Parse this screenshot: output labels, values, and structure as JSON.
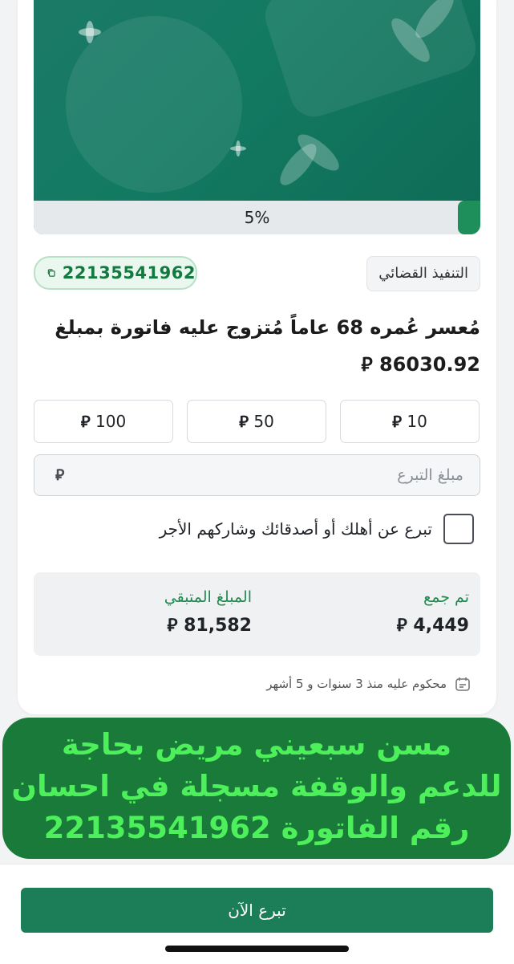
{
  "progress": {
    "percent": 0.05,
    "label": "5%"
  },
  "case": {
    "category": "التنفيذ القضائي",
    "invoice_number": "22135541962",
    "title_line1": "مُعسر عُمره 68 عاماً مُتزوج عليه فاتورة بمبلغ",
    "title_amount": "86030.92",
    "currency_symbol": "⃁"
  },
  "amount_options": [
    {
      "value": "10"
    },
    {
      "value": "50"
    },
    {
      "value": "100"
    }
  ],
  "donation_input": {
    "placeholder": "مبلغ التبرع"
  },
  "gift_option": {
    "label": "تبرع عن أهلك أو أصدقائك وشاركهم الأجر",
    "checked": false
  },
  "stats": {
    "collected_label": "تم جمع",
    "collected_value": "4,449",
    "remaining_label": "المبلغ المتبقي",
    "remaining_value": "81,582"
  },
  "status": {
    "text": "محكوم عليه منذ 3 سنوات و 5 أشهر"
  },
  "overlay": {
    "line1": "مسن سبعيني مريض بحاجة",
    "line2": "للدعم والوقفة مسجلة في احسان",
    "line3": "رقم الفاتورة 22135541962"
  },
  "cta": {
    "label": "تبرع الآن"
  },
  "colors": {
    "accent": "#1e8e5a",
    "cta": "#1c7e59",
    "overlay_bg": "#1a7a3a",
    "overlay_text": "#4df05a"
  }
}
